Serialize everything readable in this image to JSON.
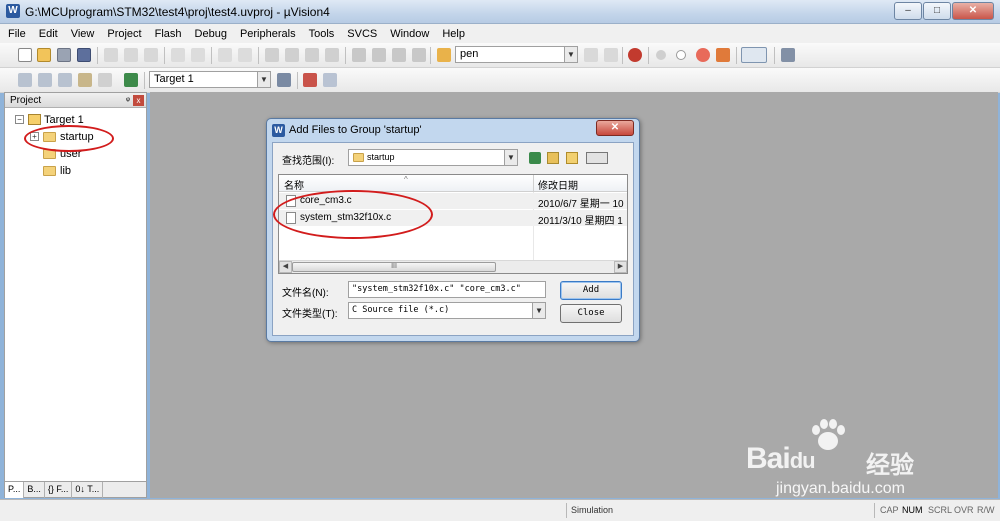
{
  "window": {
    "title": "G:\\MCUprogram\\STM32\\test4\\proj\\test4.uvproj - µVision4",
    "icon_letter": "W",
    "minimize_glyph": "–",
    "maximize_glyph": "□",
    "close_glyph": "✕"
  },
  "menu": [
    "File",
    "Edit",
    "View",
    "Project",
    "Flash",
    "Debug",
    "Peripherals",
    "Tools",
    "SVCS",
    "Window",
    "Help"
  ],
  "toolbar": {
    "find_combo_value": "pen",
    "target_combo_value": "Target 1"
  },
  "project_pane": {
    "title": "Project",
    "pin_glyph": "ᵠ",
    "close_glyph": "x",
    "tree": {
      "root": "Target 1",
      "groups": [
        "startup",
        "user",
        "lib"
      ]
    },
    "tabs": [
      "P...",
      "B...",
      "{} F...",
      "0↓ T..."
    ]
  },
  "dialog": {
    "title": "Add Files to Group 'startup'",
    "close_glyph": "✕",
    "look_in_label": "查找范围(I):",
    "look_in_value": "startup",
    "columns": {
      "name": "名称",
      "date": "修改日期"
    },
    "files": [
      {
        "name": "core_cm3.c",
        "date": "2010/6/7 星期一 10"
      },
      {
        "name": "system_stm32f10x.c",
        "date": "2011/3/10 星期四 1"
      }
    ],
    "scroll_thumb_grip": "III",
    "filename_label": "文件名(N):",
    "filename_value": "\"system_stm32f10x.c\" \"core_cm3.c\"",
    "filetype_label": "文件类型(T):",
    "filetype_value": "C Source file (*.c)",
    "add_button": "Add",
    "close_button": "Close"
  },
  "statusbar": {
    "mode": "Simulation",
    "indicators": [
      "CAP",
      "NUM",
      "SCRL",
      "OVR",
      "R/W"
    ]
  },
  "watermark": {
    "brand": "Bai",
    "brand_suffix": "du",
    "jingyan": "经验",
    "url": "jingyan.baidu.com"
  },
  "colors": {
    "annotation": "#d21c1c",
    "titlebar": "#c3d5ea",
    "workspace": "#a9a9a9"
  }
}
